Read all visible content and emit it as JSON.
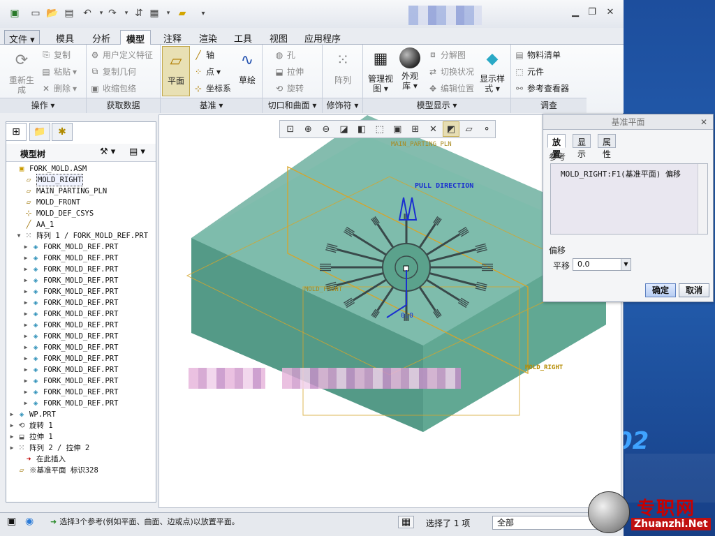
{
  "app": {
    "tabs": [
      "文件",
      "模具",
      "分析",
      "模型",
      "注释",
      "渲染",
      "工具",
      "视图",
      "应用程序"
    ],
    "active_tab": "模型"
  },
  "ribbon": {
    "groups": {
      "operations": {
        "label": "操作 ▾",
        "regenerate": "重新生\n成",
        "copy": "复制",
        "paste": "粘贴",
        "delete": "删除"
      },
      "get_data": {
        "label": "获取数据",
        "udf": "用户定义特征",
        "copy_geom": "复制几何",
        "shrinkwrap": "收缩包络"
      },
      "datum": {
        "label": "基准 ▾",
        "plane": "平面",
        "axis": "轴",
        "point": "点",
        "csys": "坐标系",
        "sketch": "草绘"
      },
      "cut_surface": {
        "label": "切口和曲面 ▾",
        "hole": "孔",
        "extrude": "拉伸",
        "revolve": "旋转"
      },
      "modifier": {
        "label": "修饰符 ▾",
        "pattern": "阵列"
      },
      "model_display": {
        "label": "模型显示 ▾",
        "manage_views": "管理视\n图 ▾",
        "appearance": "外观\n库 ▾",
        "explode": "分解图",
        "toggle_state": "切换状况",
        "edit_position": "编辑位置",
        "display_style": "显示样\n式 ▾"
      },
      "investigate": {
        "label": "调查",
        "bom": "物料清单",
        "component": "元件",
        "reference_viewer": "参考查看器"
      }
    }
  },
  "model_tree": {
    "title": "模型树",
    "items": [
      {
        "label": "FORK_MOLD.ASM",
        "icon": "assembly-icon",
        "indent": 0,
        "expander": ""
      },
      {
        "label": "MOLD_RIGHT",
        "icon": "datum-plane-icon",
        "indent": 1,
        "expander": "",
        "selected": true
      },
      {
        "label": "MAIN_PARTING_PLN",
        "icon": "datum-plane-icon",
        "indent": 1,
        "expander": ""
      },
      {
        "label": "MOLD_FRONT",
        "icon": "datum-plane-icon",
        "indent": 1,
        "expander": ""
      },
      {
        "label": "MOLD_DEF_CSYS",
        "icon": "csys-icon",
        "indent": 1,
        "expander": ""
      },
      {
        "label": "AA_1",
        "icon": "axis-icon",
        "indent": 1,
        "expander": ""
      },
      {
        "label": "阵列 1 / FORK_MOLD_REF.PRT",
        "icon": "pattern-icon",
        "indent": 1,
        "expander": "▼"
      },
      {
        "label": "FORK_MOLD_REF.PRT",
        "icon": "part-icon",
        "indent": 2,
        "expander": "▶"
      },
      {
        "label": "FORK_MOLD_REF.PRT",
        "icon": "part-icon",
        "indent": 2,
        "expander": "▶"
      },
      {
        "label": "FORK_MOLD_REF.PRT",
        "icon": "part-icon",
        "indent": 2,
        "expander": "▶"
      },
      {
        "label": "FORK_MOLD_REF.PRT",
        "icon": "part-icon",
        "indent": 2,
        "expander": "▶"
      },
      {
        "label": "FORK_MOLD_REF.PRT",
        "icon": "part-icon",
        "indent": 2,
        "expander": "▶"
      },
      {
        "label": "FORK_MOLD_REF.PRT",
        "icon": "part-icon",
        "indent": 2,
        "expander": "▶"
      },
      {
        "label": "FORK_MOLD_REF.PRT",
        "icon": "part-icon",
        "indent": 2,
        "expander": "▶"
      },
      {
        "label": "FORK_MOLD_REF.PRT",
        "icon": "part-icon",
        "indent": 2,
        "expander": "▶"
      },
      {
        "label": "FORK_MOLD_REF.PRT",
        "icon": "part-icon",
        "indent": 2,
        "expander": "▶"
      },
      {
        "label": "FORK_MOLD_REF.PRT",
        "icon": "part-icon",
        "indent": 2,
        "expander": "▶"
      },
      {
        "label": "FORK_MOLD_REF.PRT",
        "icon": "part-icon",
        "indent": 2,
        "expander": "▶"
      },
      {
        "label": "FORK_MOLD_REF.PRT",
        "icon": "part-icon",
        "indent": 2,
        "expander": "▶"
      },
      {
        "label": "FORK_MOLD_REF.PRT",
        "icon": "part-icon",
        "indent": 2,
        "expander": "▶"
      },
      {
        "label": "FORK_MOLD_REF.PRT",
        "icon": "part-icon",
        "indent": 2,
        "expander": "▶"
      },
      {
        "label": "FORK_MOLD_REF.PRT",
        "icon": "part-icon",
        "indent": 2,
        "expander": "▶"
      },
      {
        "label": "WP.PRT",
        "icon": "part-icon",
        "indent": 0,
        "expander": "▶"
      },
      {
        "label": "旋转 1",
        "icon": "revolve-icon",
        "indent": 0,
        "expander": "▶"
      },
      {
        "label": "拉伸 1",
        "icon": "extrude-icon",
        "indent": 0,
        "expander": "▶"
      },
      {
        "label": "阵列 2 / 拉伸 2",
        "icon": "pattern-icon",
        "indent": 0,
        "expander": "▶"
      },
      {
        "label": "在此插入",
        "icon": "insert-here-icon",
        "indent": 1,
        "expander": ""
      },
      {
        "label": "※基准平面 标识328",
        "icon": "datum-plane-icon",
        "indent": 0,
        "expander": ""
      }
    ]
  },
  "viewport": {
    "labels": {
      "main_parting": "MAIN_PARTING_PLN",
      "pull_direction": "PULL DIRECTION",
      "mold_front": "MOLD_FRONT",
      "mold_right": "MOLD_RIGHT",
      "offset_value": "0.0"
    }
  },
  "dialog": {
    "title": "基准平面",
    "close": "✕",
    "tabs": [
      "放置",
      "显示",
      "属性"
    ],
    "references_label": "参考",
    "reference_item": "MOLD_RIGHT:F1(基准平面)  偏移",
    "offset_label": "偏移",
    "translate_label": "平移",
    "translate_value": "0.0",
    "ok": "确定",
    "cancel": "取消"
  },
  "status": {
    "message": "选择3个参考(例如平面、曲面、边或点)以放置平面。",
    "selected_count": "选择了 1 项",
    "filter": "全部"
  },
  "watermark": {
    "brand": "专职网",
    "url": "Zhuanzhi.Net",
    "desktop_text": "02"
  },
  "colors": {
    "mold_fill": "#5fa894",
    "mold_edge": "#3a7b6a",
    "datum_plane": "#d7a52c",
    "label_blue": "#1a2fd0",
    "accent": "#2b7bd8"
  }
}
